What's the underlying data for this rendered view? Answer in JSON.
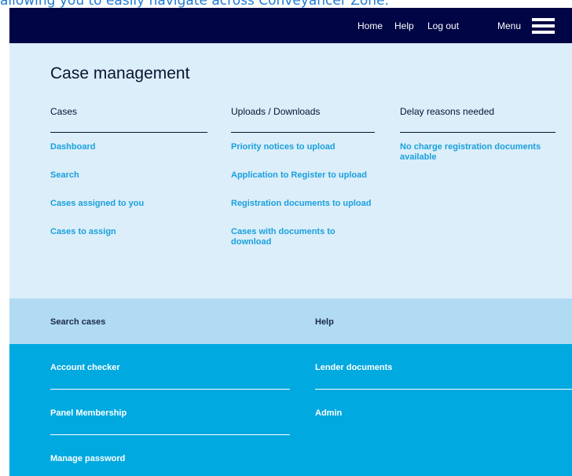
{
  "caption": "allowing you to easily navigate across Conveyancer Zone.",
  "topbar": {
    "home": "Home",
    "help": "Help",
    "logout": "Log out",
    "menu": "Menu"
  },
  "case_management": {
    "title": "Case management",
    "columns": [
      {
        "heading": "Cases",
        "links": [
          "Dashboard",
          "Search",
          "Cases assigned to you",
          "Cases to assign"
        ]
      },
      {
        "heading": "Uploads / Downloads",
        "links": [
          "Priority notices to upload",
          "Application to Register to upload",
          "Registration documents to upload",
          "Cases with documents to download"
        ]
      },
      {
        "heading": "Delay reasons needed",
        "links": [
          "No charge registration documents available"
        ]
      }
    ]
  },
  "secondary_nav": {
    "search_cases": "Search cases",
    "help": "Help"
  },
  "footer_nav": {
    "account_checker": "Account checker",
    "lender_documents": "Lender documents",
    "panel_membership": "Panel Membership",
    "admin": "Admin",
    "manage_password": "Manage password"
  },
  "colors": {
    "topbar_bg": "#000645",
    "panel_bg": "#dbeefa",
    "light_band": "#b1daf3",
    "dark_band": "#00a9e0",
    "link": "#1aa0dc"
  }
}
